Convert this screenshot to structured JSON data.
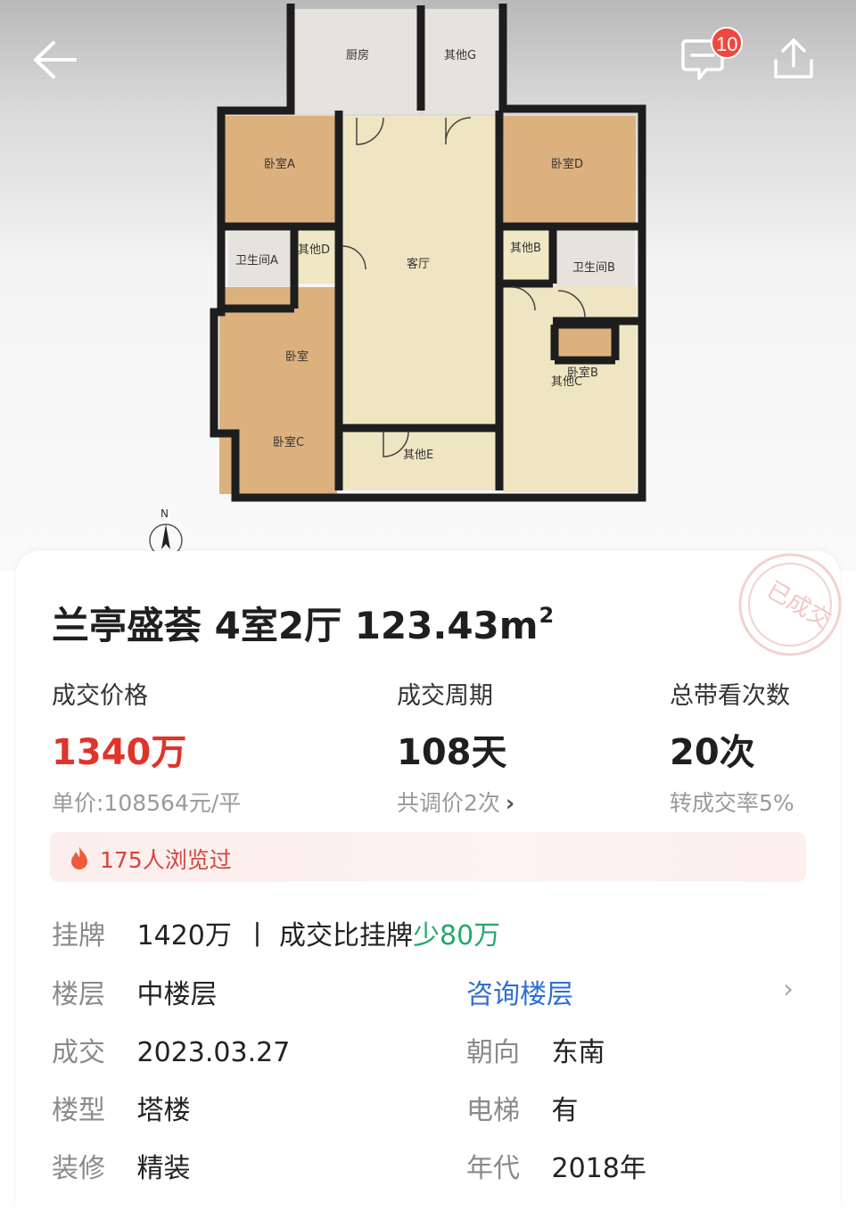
{
  "header": {
    "message_count": "10",
    "icons": [
      "back-arrow-icon",
      "message-icon",
      "share-icon"
    ]
  },
  "floorplan": {
    "rooms": {
      "kitchen": "厨房",
      "other_g": "其他G",
      "bedroom_a": "卧室A",
      "bedroom_d": "卧室D",
      "bath_a": "卫生间A",
      "other_d": "其他D",
      "living": "客厅",
      "other_b": "其他B",
      "bath_b": "卫生间B",
      "bedroom": "卧室",
      "bedroom_b": "卧室B",
      "other_c": "其他C",
      "bedroom_c": "卧室C",
      "other_e": "其他E"
    },
    "compass_label": "N",
    "stamp_text": "已成交"
  },
  "listing": {
    "title_main": "兰亭盛荟 4室2厅 123.43m",
    "title_sup": "2"
  },
  "stats": [
    {
      "label": "成交价格",
      "value": "1340万",
      "sub": "单价:108564元/平"
    },
    {
      "label": "成交周期",
      "value": "108天",
      "sub": "共调价2次"
    },
    {
      "label": "总带看次数",
      "value": "20次",
      "sub": "转成交率5%"
    }
  ],
  "views": {
    "text": "175人浏览过"
  },
  "details": {
    "listing_key": "挂牌",
    "listing_value": "1420万",
    "separator": "丨",
    "compare_text": "成交比挂牌",
    "compare_diff": "少80万",
    "floor_key": "楼层",
    "floor_value": "中楼层",
    "floor_link": "咨询楼层",
    "deal_key": "成交",
    "deal_value": "2023.03.27",
    "orient_key": "朝向",
    "orient_value": "东南",
    "type_key": "楼型",
    "type_value": "塔楼",
    "elevator_key": "电梯",
    "elevator_value": "有",
    "deco_key": "装修",
    "deco_value": "精装",
    "year_key": "年代",
    "year_value": "2018年"
  },
  "colors": {
    "price_red": "#e0342b",
    "diff_green": "#27a86b",
    "link_blue": "#2f6fd1",
    "badge_red": "#f0483e"
  }
}
